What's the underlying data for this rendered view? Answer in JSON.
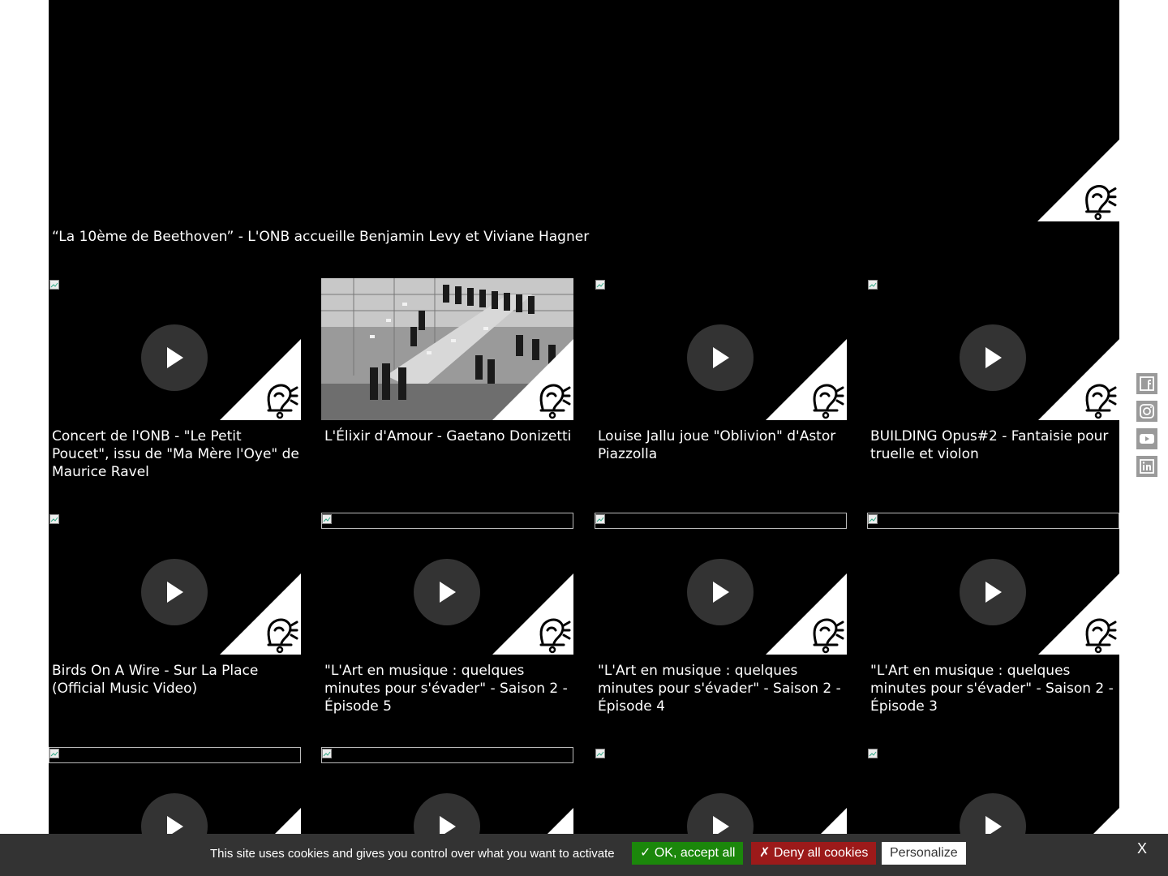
{
  "hero": {
    "title": "“La 10ème de Beethoven” - L'ONB accueille Benjamin Levy et Viviane Hagner"
  },
  "videos": [
    {
      "title": "Concert de l'ONB - \"Le Petit Poucet\", issu de \"Ma Mère l'Oye\" de Maurice Ravel"
    },
    {
      "title": "L'Élixir d'Amour - Gaetano Donizetti"
    },
    {
      "title": "Louise Jallu joue \"Oblivion\" d'Astor Piazzolla"
    },
    {
      "title": "BUILDING Opus#2 - Fantaisie pour truelle et violon"
    },
    {
      "title": "Birds On A Wire - Sur La Place (Official Music Video)"
    },
    {
      "title": "\"L'Art en musique : quelques minutes pour s'évader\" - Saison 2 - Épisode 5"
    },
    {
      "title": "\"L'Art en musique : quelques minutes pour s'évader\" - Saison 2 - Épisode 4"
    },
    {
      "title": "\"L'Art en musique : quelques minutes pour s'évader\" - Saison 2 - Épisode 3"
    }
  ],
  "social": [
    "facebook-icon",
    "instagram-icon",
    "youtube-icon",
    "linkedin-icon"
  ],
  "cookie": {
    "message": "This site uses cookies and gives you control over what you want to activate",
    "accept_label": "✓ OK, accept all",
    "deny_label": "✗ Deny all cookies",
    "personalize_label": "Personalize",
    "close_label": "X"
  },
  "colors": {
    "background": "#000000",
    "accept": "#1b870b",
    "deny": "#9c1a1a",
    "cookie_bar": "#333333"
  }
}
